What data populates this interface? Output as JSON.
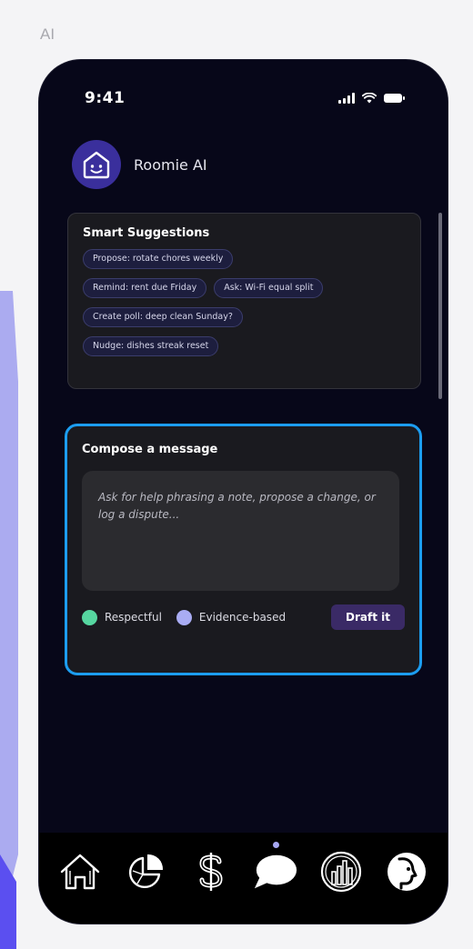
{
  "page_label": "AI",
  "status_bar": {
    "time": "9:41"
  },
  "header": {
    "app_name": "Roomie AI",
    "avatar_icon": "smiley-house-icon"
  },
  "suggestions": {
    "title": "Smart Suggestions",
    "rows": [
      [
        "Propose: rotate chores weekly"
      ],
      [
        "Remind: rent due Friday",
        "Ask: Wi-Fi equal split"
      ],
      [
        "Create poll: deep clean Sunday?"
      ],
      [
        "Nudge: dishes streak reset"
      ]
    ]
  },
  "compose": {
    "title": "Compose a message",
    "placeholder": "Ask for help phrasing a note, propose a change, or log a dispute...",
    "tones": [
      {
        "label": "Respectful",
        "color": "#56d6a0"
      },
      {
        "label": "Evidence-based",
        "color": "#a9acf4"
      }
    ],
    "draft_label": "Draft it"
  },
  "tab_bar": {
    "items": [
      {
        "icon": "home-icon"
      },
      {
        "icon": "pie-chart-icon"
      },
      {
        "icon": "dollar-icon"
      },
      {
        "icon": "chat-icon",
        "active": true
      },
      {
        "icon": "bar-chart-icon"
      },
      {
        "icon": "ai-face-icon"
      }
    ]
  },
  "colors": {
    "accent_blue": "#1c9df0",
    "phone_bg": "#070719",
    "avatar_bg": "#3a2f9c",
    "draft_button": "#3a2a66"
  }
}
